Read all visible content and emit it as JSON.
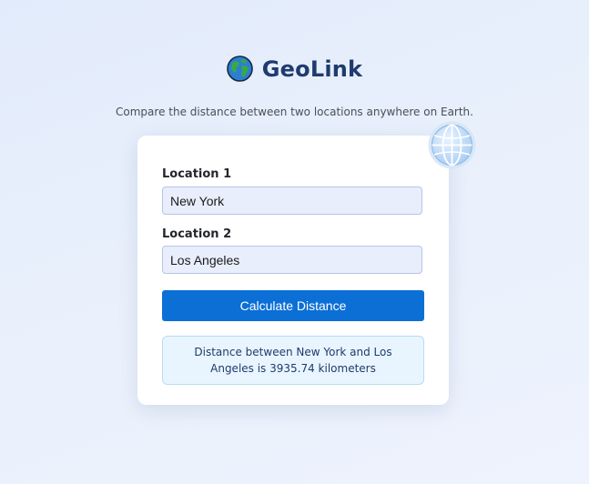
{
  "header": {
    "app_title": "GeoLink",
    "logo_icon": "earth-globe-icon"
  },
  "subtitle": "Compare the distance between two locations anywhere on Earth.",
  "form": {
    "location1_label": "Location 1",
    "location1_value": "New York",
    "location2_label": "Location 2",
    "location2_value": "Los Angeles",
    "calculate_button_label": "Calculate Distance"
  },
  "result": {
    "text": "Distance between New York and Los Angeles is 3935.74 kilometers"
  },
  "decorations": {
    "globe_icon": "globe-grid-icon"
  },
  "colors": {
    "accent": "#0b6fd6",
    "title": "#1f3b6e",
    "result_background": "#e9f5fe"
  }
}
